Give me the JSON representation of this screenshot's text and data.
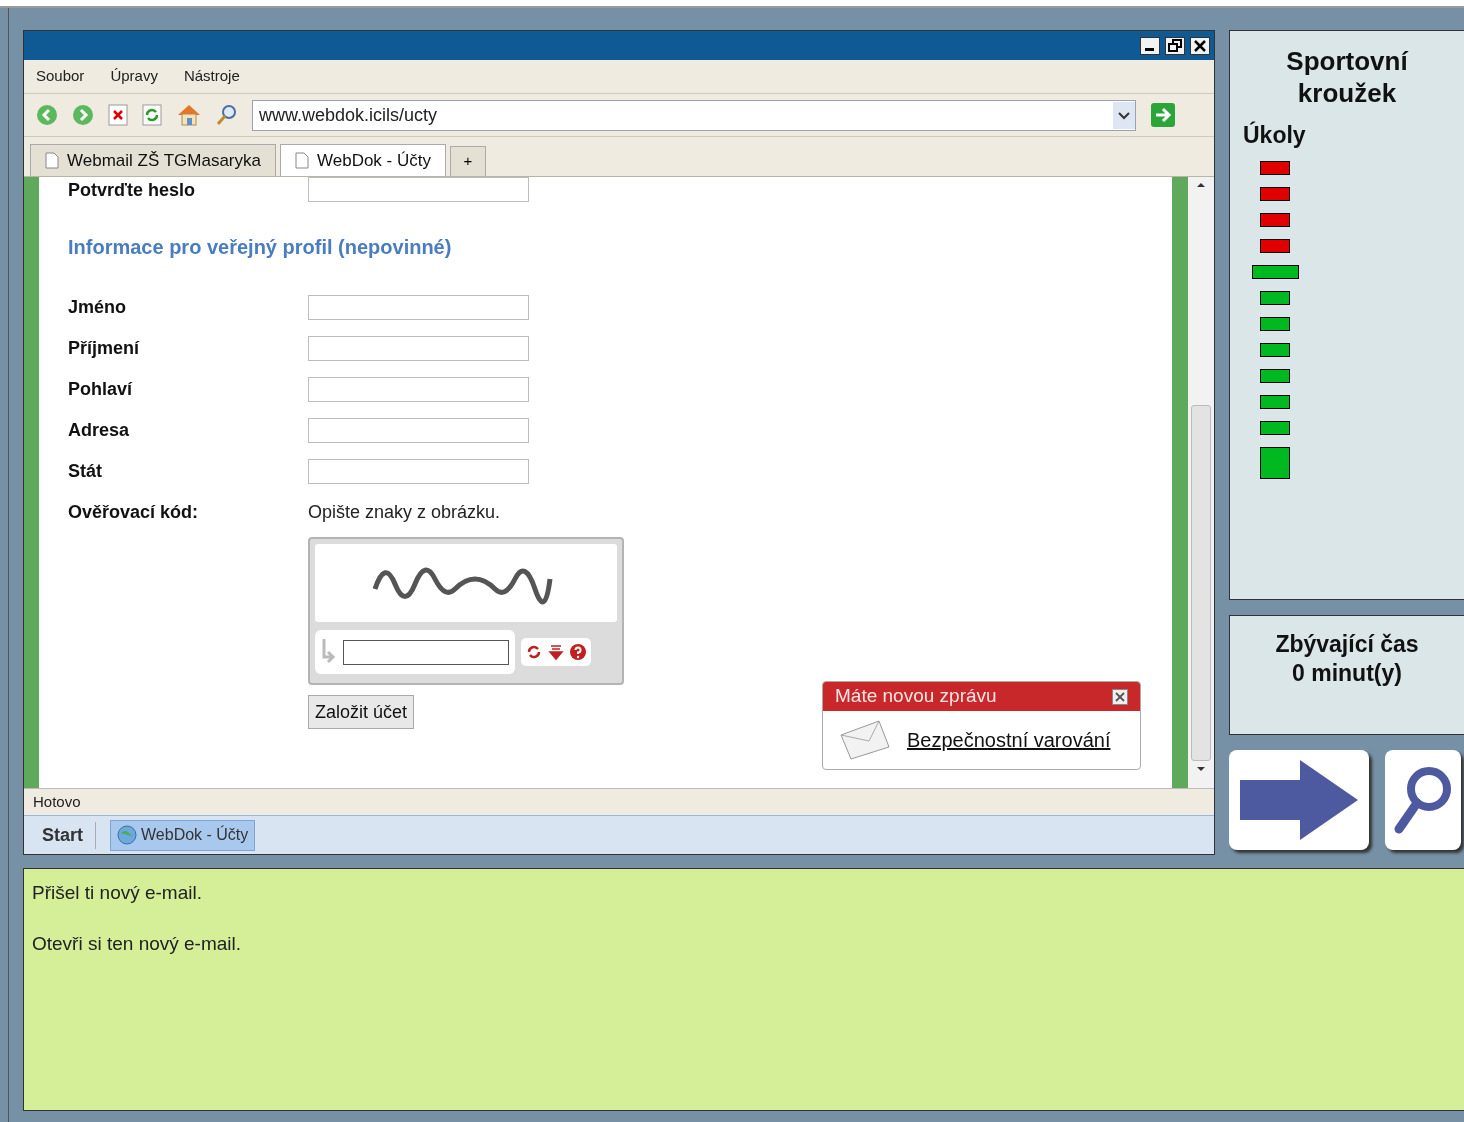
{
  "browser": {
    "menu": [
      "Soubor",
      "Úpravy",
      "Nástroje"
    ],
    "address": "www.webdok.icils/ucty",
    "tabs": [
      {
        "label": "Webmail ZŠ TGMasaryka",
        "selected": false
      },
      {
        "label": "WebDok - Účty",
        "selected": true
      }
    ],
    "new_tab": "+",
    "status_bar": "Hotovo"
  },
  "form": {
    "confirm_password_label": "Potvrďte heslo",
    "section_heading": "Informace pro veřejný profil (nepovinné)",
    "fields": [
      {
        "label": "Jméno"
      },
      {
        "label": "Příjmení"
      },
      {
        "label": "Pohlaví"
      },
      {
        "label": "Adresa"
      },
      {
        "label": "Stát"
      }
    ],
    "captcha_label": "Ověřovací kód:",
    "captcha_hint": "Opište znaky z obrázku.",
    "submit": "Založit účet"
  },
  "notification": {
    "title": "Máte novou zprávu",
    "link": "Bezpečnostní varování"
  },
  "taskbar": {
    "start": "Start",
    "items": [
      "WebDok - Účty"
    ]
  },
  "side": {
    "title": "Sportovní kroužek",
    "tasks_label": "Úkoly",
    "tasks": [
      {
        "kind": "task",
        "color": "#e00000",
        "selected": false
      },
      {
        "kind": "task",
        "color": "#e00000",
        "selected": false
      },
      {
        "kind": "task",
        "color": "#e00000",
        "selected": false
      },
      {
        "kind": "task",
        "color": "#e00000",
        "selected": false
      },
      {
        "kind": "task",
        "color": "#00b81f",
        "selected": true
      },
      {
        "kind": "task",
        "color": "#00b81f",
        "selected": false
      },
      {
        "kind": "task",
        "color": "#00b81f",
        "selected": false
      },
      {
        "kind": "task",
        "color": "#00b81f",
        "selected": false
      },
      {
        "kind": "task",
        "color": "#00b81f",
        "selected": false
      },
      {
        "kind": "task",
        "color": "#00b81f",
        "selected": false
      },
      {
        "kind": "task",
        "color": "#00b81f",
        "selected": false
      },
      {
        "kind": "final",
        "color": "#00b81f",
        "selected": false
      }
    ],
    "timer_label": "Zbývající čas",
    "timer_value": "0 minut(y)"
  },
  "instructions": [
    "Přišel ti nový e-mail.",
    "Otevři si ten nový e-mail."
  ]
}
